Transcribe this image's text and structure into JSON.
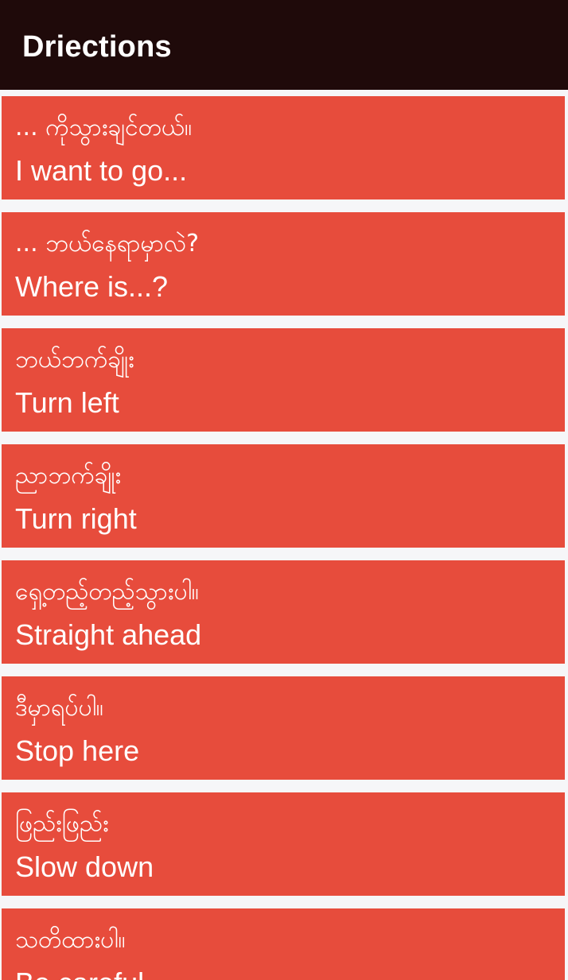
{
  "app_bar": {
    "title": "Driections",
    "background_color": "#1f0a0a"
  },
  "card_color": "#e74c3c",
  "phrases": [
    {
      "burmese": "... ကိုသွားချင်တယ်။",
      "english": "I want to go..."
    },
    {
      "burmese": "... ဘယ်နေရာမှာလဲ?",
      "english": "Where is...?"
    },
    {
      "burmese": "ဘယ်ဘက်ချိုး",
      "english": "Turn left"
    },
    {
      "burmese": "ညာဘက်ချိုး",
      "english": "Turn right"
    },
    {
      "burmese": "ရှေ့တည့်တည့်သွားပါ။",
      "english": "Straight ahead"
    },
    {
      "burmese": "ဒီမှာရပ်ပါ။",
      "english": "Stop here"
    },
    {
      "burmese": "ဖြည်းဖြည်း",
      "english": "Slow down"
    },
    {
      "burmese": "သတိထားပါ။",
      "english": "Be careful"
    }
  ]
}
